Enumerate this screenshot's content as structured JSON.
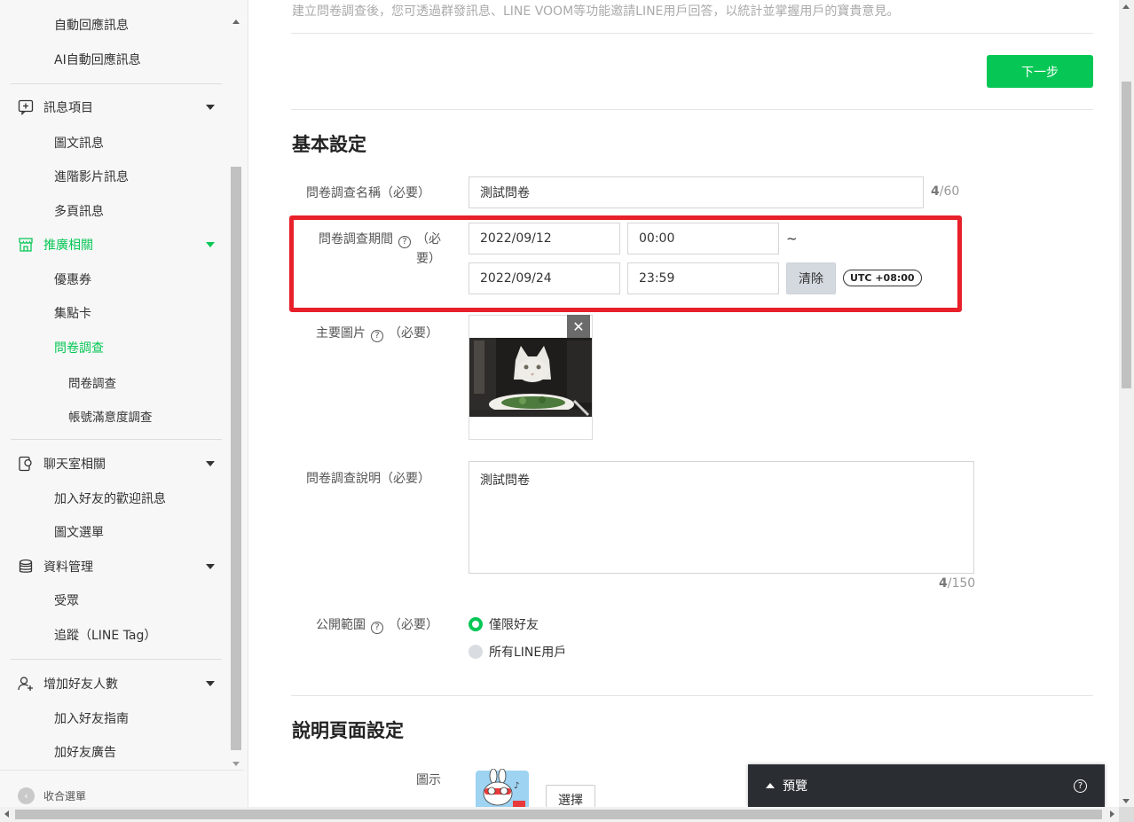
{
  "sidebar": {
    "auto_reply": "自動回應訊息",
    "ai_auto_reply": "AI自動回應訊息",
    "messages_header": "訊息項目",
    "rich_message": "圖文訊息",
    "video_message": "進階影片訊息",
    "carousel_message": "多頁訊息",
    "promo_header": "推廣相關",
    "coupon": "優惠券",
    "reward_card": "集點卡",
    "survey": "問卷調查",
    "survey_sub": "問卷調查",
    "satisfaction_survey": "帳號滿意度調查",
    "chat_header": "聊天室相關",
    "greeting_message": "加入好友的歡迎訊息",
    "rich_menu": "圖文選單",
    "data_header": "資料管理",
    "audience": "受眾",
    "line_tag": "追蹤（LINE Tag）",
    "friends_header": "增加好友人數",
    "friend_guide": "加入好友指南",
    "friend_ads": "加好友廣告",
    "collapse": "收合選單",
    "accent_color": "#06c755"
  },
  "main": {
    "intro": "建立問卷調查後，您可透過群發訊息、LINE VOOM等功能邀請LINE用戶回答，以統計並掌握用戶的寶貴意見。",
    "next_button": "下一步",
    "basic_settings_title": "基本設定",
    "name_label": "問卷調查名稱（必要）",
    "name_value": "測試問卷",
    "name_count": "4",
    "name_max": "/60",
    "period_label_a": "問卷調查期間",
    "period_label_b": "（必",
    "period_label_c": "要）",
    "start_date": "2022/09/12",
    "start_time": "00:00",
    "tilde": "~",
    "end_date": "2022/09/24",
    "end_time": "23:59",
    "clear_button": "清除",
    "utc_badge": "UTC +08:00",
    "image_label": "主要圖片",
    "required": "（必要）",
    "close_icon": "✕",
    "desc_label": "問卷調查說明（必要）",
    "desc_value": "測試問卷",
    "desc_count": "4",
    "desc_max": "/150",
    "scope_label": "公開範圍",
    "scope_option_friends": "僅限好友",
    "scope_option_all": "所有LINE用戶",
    "explain_title": "說明頁面設定",
    "icon_label": "圖示",
    "select_button": "選擇",
    "highlight_color": "#e8202a"
  },
  "preview": {
    "label": "預覽",
    "help": "?"
  }
}
